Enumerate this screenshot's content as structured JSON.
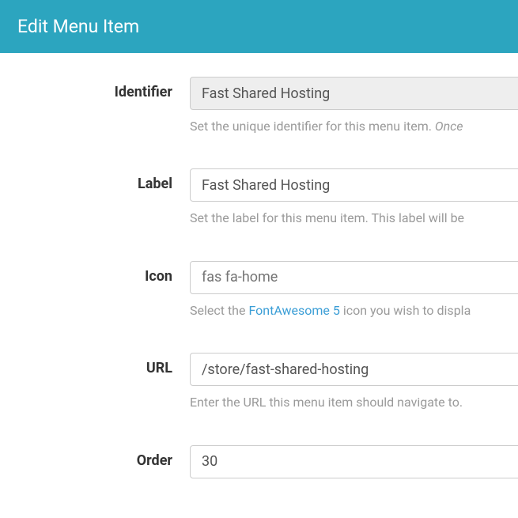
{
  "header": {
    "title": "Edit Menu Item"
  },
  "form": {
    "identifier": {
      "label": "Identifier",
      "value": "Fast Shared Hosting",
      "help_prefix": "Set the unique identifier for this menu item. ",
      "help_italic": "Once"
    },
    "label_field": {
      "label": "Label",
      "value": "Fast Shared Hosting",
      "help": "Set the label for this menu item. This label will be"
    },
    "icon": {
      "label": "Icon",
      "value": "",
      "placeholder": "fas fa-home",
      "help_prefix": "Select the ",
      "help_link": "FontAwesome 5",
      "help_suffix": " icon you wish to displa"
    },
    "url": {
      "label": "URL",
      "value": "/store/fast-shared-hosting",
      "help": "Enter the URL this menu item should navigate to."
    },
    "order": {
      "label": "Order",
      "value": "30"
    }
  }
}
